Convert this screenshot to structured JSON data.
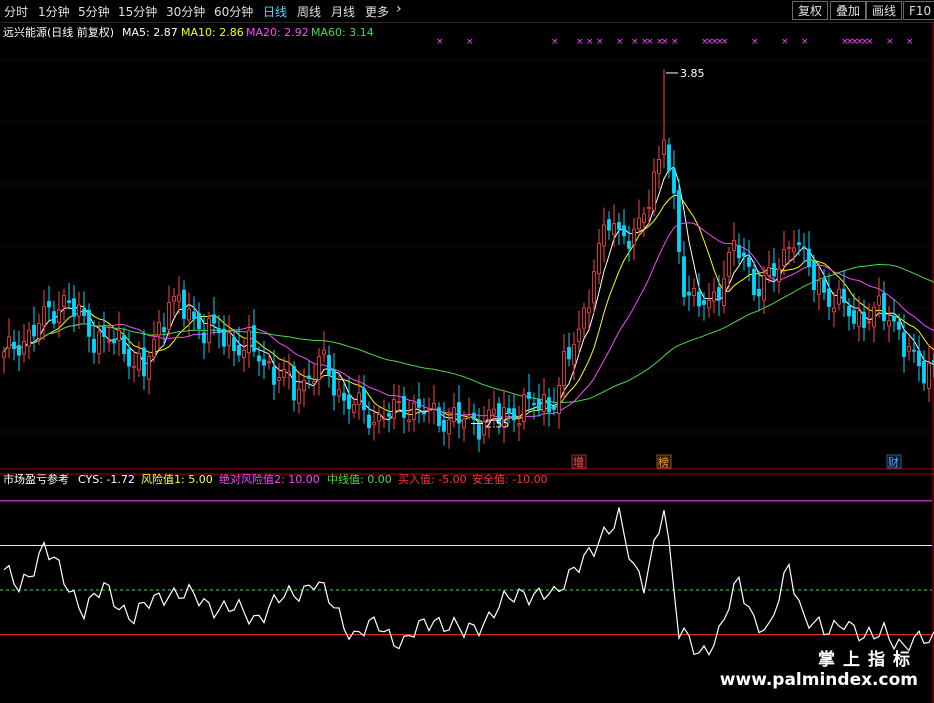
{
  "toolbar": {
    "periods": [
      "分时",
      "1分钟",
      "5分钟",
      "15分钟",
      "30分钟",
      "60分钟",
      "日线",
      "周线",
      "月线",
      "更多"
    ],
    "active_period": "日线",
    "more_chevron": "›",
    "buttons": [
      "复权",
      "叠加",
      "画线",
      "F10"
    ]
  },
  "colors": {
    "background": "#000000",
    "up": "#ff4444",
    "down": "#00d8ff",
    "ma5": "#ffffff",
    "ma10": "#ffff00",
    "ma20": "#ff44ff",
    "ma60": "#44dd44",
    "grid": "#7a0000",
    "cys": "#ffffff"
  },
  "chart_data": [
    {
      "type": "candlestick",
      "title": "远兴能源(日线 前复权)",
      "legend": [
        {
          "label": "MA5: 2.87",
          "color": "#ffffff"
        },
        {
          "label": "MA10: 2.86",
          "color": "#ffff00"
        },
        {
          "label": "MA20: 2.92",
          "color": "#ff44ff"
        },
        {
          "label": "MA60: 3.14",
          "color": "#44dd44"
        }
      ],
      "ylim": [
        2.4,
        3.95
      ],
      "grid": "dotted horizontal",
      "annotations": [
        {
          "label": "3.85",
          "kind": "high",
          "bar": 132
        },
        {
          "label": "2.55",
          "kind": "low",
          "bar": 93
        }
      ],
      "event_tags": [
        {
          "label": "增",
          "bar": 115,
          "color": "#ff5555"
        },
        {
          "label": "榜",
          "bar": 132,
          "color": "#ff9933"
        },
        {
          "label": "财",
          "bar": 178,
          "color": "#55aaff"
        }
      ],
      "signal_bars": [
        87,
        93,
        110,
        115,
        117,
        119,
        123,
        126,
        128,
        129,
        131,
        132,
        134,
        140,
        141,
        142,
        143,
        144,
        150,
        156,
        160,
        168,
        169,
        170,
        171,
        172,
        173,
        177,
        181
      ],
      "key_points": [
        {
          "bar": 0,
          "close": 2.78
        },
        {
          "bar": 8,
          "close": 2.92
        },
        {
          "bar": 12,
          "close": 3.0
        },
        {
          "bar": 18,
          "close": 2.86
        },
        {
          "bar": 24,
          "close": 2.82
        },
        {
          "bar": 28,
          "close": 2.72
        },
        {
          "bar": 33,
          "close": 3.0
        },
        {
          "bar": 38,
          "close": 2.92
        },
        {
          "bar": 44,
          "close": 2.85
        },
        {
          "bar": 50,
          "close": 2.8
        },
        {
          "bar": 58,
          "close": 2.66
        },
        {
          "bar": 64,
          "close": 2.76
        },
        {
          "bar": 68,
          "close": 2.62
        },
        {
          "bar": 75,
          "close": 2.55
        },
        {
          "bar": 80,
          "close": 2.6
        },
        {
          "bar": 87,
          "close": 2.56
        },
        {
          "bar": 93,
          "close": 2.54
        },
        {
          "bar": 99,
          "close": 2.56
        },
        {
          "bar": 105,
          "close": 2.6
        },
        {
          "bar": 110,
          "close": 2.62
        },
        {
          "bar": 116,
          "close": 2.95
        },
        {
          "bar": 121,
          "close": 3.3
        },
        {
          "bar": 126,
          "close": 3.2
        },
        {
          "bar": 130,
          "close": 3.45
        },
        {
          "bar": 132,
          "close": 3.6
        },
        {
          "bar": 136,
          "close": 3.05
        },
        {
          "bar": 141,
          "close": 2.95
        },
        {
          "bar": 146,
          "close": 3.2
        },
        {
          "bar": 150,
          "close": 3.05
        },
        {
          "bar": 155,
          "close": 3.1
        },
        {
          "bar": 158,
          "close": 3.25
        },
        {
          "bar": 162,
          "close": 3.05
        },
        {
          "bar": 166,
          "close": 3.0
        },
        {
          "bar": 170,
          "close": 2.92
        },
        {
          "bar": 174,
          "close": 2.95
        },
        {
          "bar": 178,
          "close": 2.92
        },
        {
          "bar": 183,
          "close": 2.72
        },
        {
          "bar": 186,
          "close": 2.77
        }
      ]
    },
    {
      "type": "line",
      "title": "市场盈亏参考",
      "legend": [
        {
          "label": "CYS: -1.72",
          "color": "#ffffff"
        },
        {
          "label": "风险值1: 5.00",
          "color": "#ffff44"
        },
        {
          "label": "绝对风险值2: 10.00",
          "color": "#ff44ff"
        },
        {
          "label": "中线值: 0.00",
          "color": "#44dd44"
        },
        {
          "label": "买入值: -5.00",
          "color": "#ff3333"
        },
        {
          "label": "安全值: -10.00",
          "color": "#ff3333"
        }
      ],
      "ylim": [
        -12,
        11
      ],
      "reference_lines": [
        {
          "name": "绝对风险值2",
          "value": 10,
          "color": "#ff44ff",
          "dash": false
        },
        {
          "name": "风险值1",
          "value": 5,
          "color": "#ffff44",
          "dash": false
        },
        {
          "name": "中线值",
          "value": 0,
          "color": "#44dd44",
          "dash": true
        },
        {
          "name": "买入值",
          "value": -5,
          "color": "#ff3333",
          "dash": false
        }
      ],
      "key_points": [
        {
          "bar": 0,
          "value": 2
        },
        {
          "bar": 3,
          "value": 0
        },
        {
          "bar": 8,
          "value": 5
        },
        {
          "bar": 12,
          "value": 1
        },
        {
          "bar": 16,
          "value": -2
        },
        {
          "bar": 20,
          "value": 0
        },
        {
          "bar": 26,
          "value": -3
        },
        {
          "bar": 33,
          "value": 0
        },
        {
          "bar": 38,
          "value": -1
        },
        {
          "bar": 44,
          "value": -2
        },
        {
          "bar": 50,
          "value": -3
        },
        {
          "bar": 56,
          "value": -1
        },
        {
          "bar": 62,
          "value": 1
        },
        {
          "bar": 66,
          "value": -2
        },
        {
          "bar": 70,
          "value": -5
        },
        {
          "bar": 75,
          "value": -4
        },
        {
          "bar": 80,
          "value": -6
        },
        {
          "bar": 86,
          "value": -3
        },
        {
          "bar": 92,
          "value": -5
        },
        {
          "bar": 99,
          "value": -2
        },
        {
          "bar": 104,
          "value": 0
        },
        {
          "bar": 110,
          "value": -1
        },
        {
          "bar": 114,
          "value": 3
        },
        {
          "bar": 118,
          "value": 4
        },
        {
          "bar": 123,
          "value": 9
        },
        {
          "bar": 126,
          "value": 2
        },
        {
          "bar": 128,
          "value": 0
        },
        {
          "bar": 130,
          "value": 5
        },
        {
          "bar": 132,
          "value": 10
        },
        {
          "bar": 135,
          "value": -5
        },
        {
          "bar": 139,
          "value": -7
        },
        {
          "bar": 143,
          "value": -5
        },
        {
          "bar": 147,
          "value": 1
        },
        {
          "bar": 150,
          "value": -3
        },
        {
          "bar": 153,
          "value": -5
        },
        {
          "bar": 157,
          "value": 3
        },
        {
          "bar": 160,
          "value": -3
        },
        {
          "bar": 164,
          "value": -5
        },
        {
          "bar": 168,
          "value": -3
        },
        {
          "bar": 172,
          "value": -6
        },
        {
          "bar": 176,
          "value": -4
        },
        {
          "bar": 180,
          "value": -7
        },
        {
          "bar": 184,
          "value": -5
        },
        {
          "bar": 186,
          "value": -5
        }
      ]
    }
  ],
  "brand": {
    "cn": "掌上指标",
    "url": "www.palmindex.com"
  }
}
